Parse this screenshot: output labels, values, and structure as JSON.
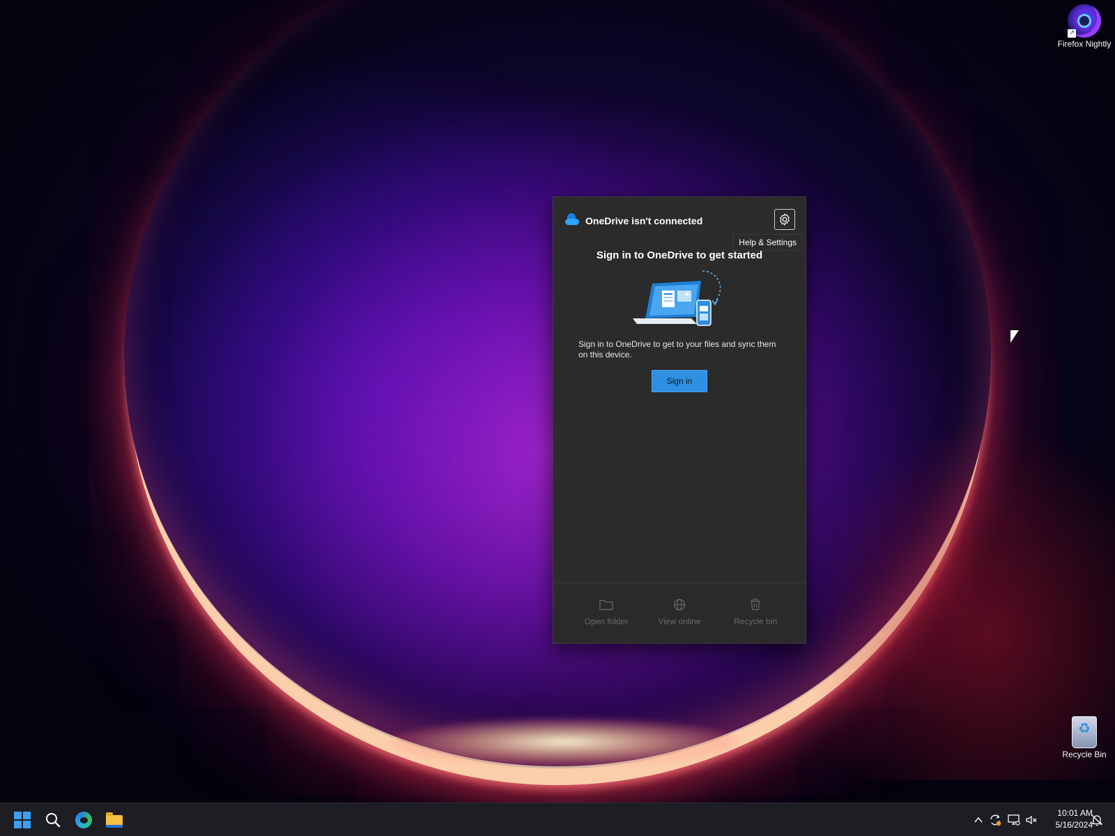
{
  "desktop": {
    "icons": [
      {
        "label": "Firefox Nightly"
      },
      {
        "label": "Recycle Bin"
      }
    ]
  },
  "onedrive": {
    "title": "OneDrive isn't connected",
    "settings_tooltip": "Help & Settings",
    "heading": "Sign in to OneDrive to get started",
    "description": "Sign in to OneDrive to get to your files and sync them on this device.",
    "sign_in_label": "Sign in",
    "footer": [
      {
        "label": "Open folder",
        "icon": "folder-icon"
      },
      {
        "label": "View online",
        "icon": "globe-icon"
      },
      {
        "label": "Recycle bin",
        "icon": "trash-icon"
      }
    ],
    "colors": {
      "panel_bg": "#2b2b2b",
      "accent": "#2f8fe0",
      "disabled_text": "#6b6b6b"
    }
  },
  "taskbar": {
    "apps": [
      {
        "icon": "windows-start-icon"
      },
      {
        "icon": "search-icon"
      },
      {
        "icon": "edge-icon"
      },
      {
        "icon": "file-explorer-icon"
      }
    ],
    "tray_icons": [
      "chevron-up-icon",
      "onedrive-sync-icon",
      "network-icon",
      "volume-muted-icon",
      "notification-icon"
    ],
    "clock": {
      "time": "10:01 AM",
      "date": "5/16/2024"
    }
  }
}
